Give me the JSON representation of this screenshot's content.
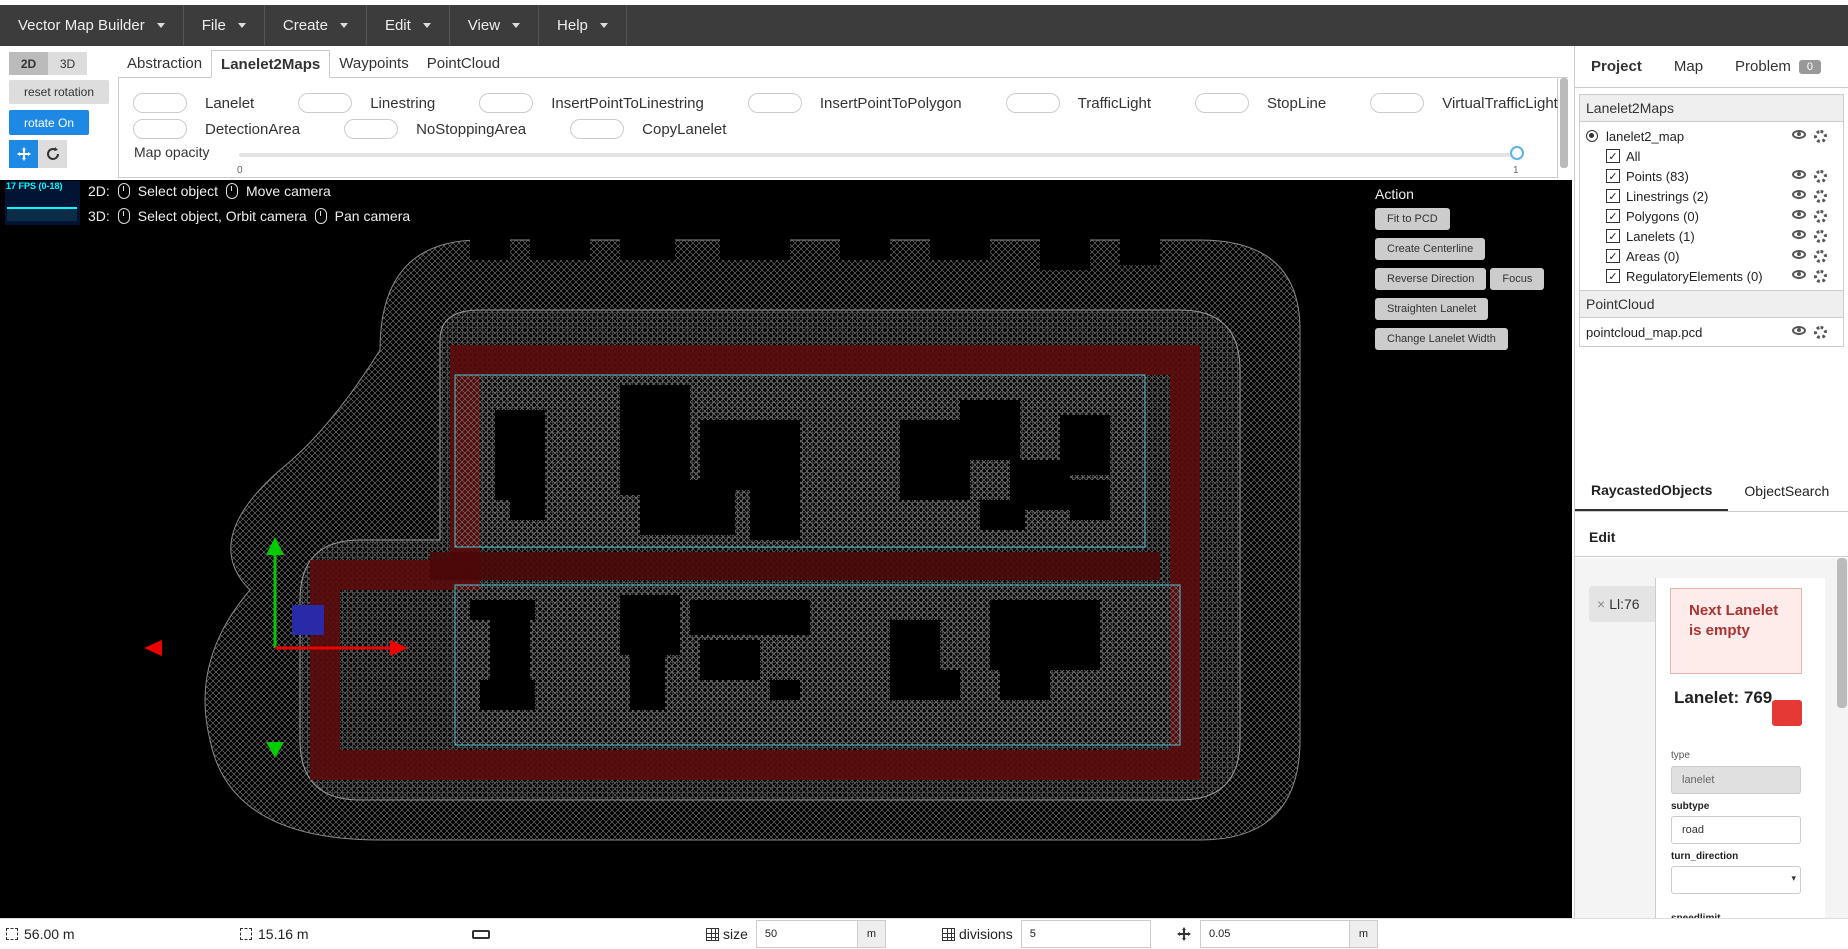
{
  "menubar": {
    "app_title": "Vector Map Builder",
    "items": [
      "File",
      "Create",
      "Edit",
      "View",
      "Help"
    ]
  },
  "view_toggle": {
    "two_d": "2D",
    "three_d": "3D",
    "active": "2D"
  },
  "left_tools": {
    "reset_rotation": "reset rotation",
    "rotate_on": "rotate On"
  },
  "tabs": [
    "Abstraction",
    "Lanelet2Maps",
    "Waypoints",
    "PointCloud"
  ],
  "active_tab": "Lanelet2Maps",
  "toggles_row1": [
    "Lanelet",
    "Linestring",
    "InsertPointToLinestring",
    "InsertPointToPolygon",
    "TrafficLight",
    "StopLine",
    "VirtualTrafficLight"
  ],
  "toggles_row2": [
    "DetectionArea",
    "NoStoppingArea",
    "CopyLanelet"
  ],
  "map_opacity": {
    "label": "Map opacity",
    "min": "0",
    "max": "1",
    "value": 1
  },
  "viewport": {
    "fps": "17 FPS (0-18)",
    "hint_2d_prefix": "2D:",
    "hint_2d_left": "Select object",
    "hint_2d_right": "Move camera",
    "hint_3d_prefix": "3D:",
    "hint_3d_left": "Select object, Orbit camera",
    "hint_3d_right": "Pan camera"
  },
  "action": {
    "title": "Action",
    "fit_to_pcd": "Fit to PCD",
    "create_centerline": "Create Centerline",
    "reverse_direction": "Reverse Direction",
    "focus": "Focus",
    "straighten_lanelet": "Straighten Lanelet",
    "change_lanelet_width": "Change Lanelet Width"
  },
  "right_panel": {
    "tabs": [
      "Project",
      "Map",
      "Problem"
    ],
    "problem_count": "0",
    "lanelet_section_title": "Lanelet2Maps",
    "map_name": "lanelet2_map",
    "tree_items": [
      "All",
      "Points (83)",
      "Linestrings (2)",
      "Polygons (0)",
      "Lanelets (1)",
      "Areas (0)",
      "RegulatoryElements (0)"
    ],
    "pointcloud_section_title": "PointCloud",
    "pointcloud_file": "pointcloud_map.pcd",
    "lower_tabs": [
      "RaycastedObjects",
      "ObjectSearch"
    ],
    "edit_title": "Edit",
    "chip_label": "Ll:76",
    "alert": "Next Lanelet is empty",
    "lanelet_title": "Lanelet: 769",
    "type_label": "type",
    "type_value": "lanelet",
    "subtype_label": "subtype",
    "subtype_value": "road",
    "turn_direction_label": "turn_direction",
    "turn_direction_value": "",
    "speedlimit_label": "speedlimit"
  },
  "status": {
    "distance": "56.00 m",
    "width": "15.16 m",
    "size_label": "size",
    "size_value": "50",
    "size_unit": "m",
    "divisions_label": "divisions",
    "divisions_value": "5",
    "step_value": "0.05",
    "step_unit": "m"
  },
  "colors": {
    "accent": "#1e88e5",
    "menubar": "#3c3c3c",
    "lane_red": "#5a0a0a",
    "boundary": "#4fc3d9"
  }
}
